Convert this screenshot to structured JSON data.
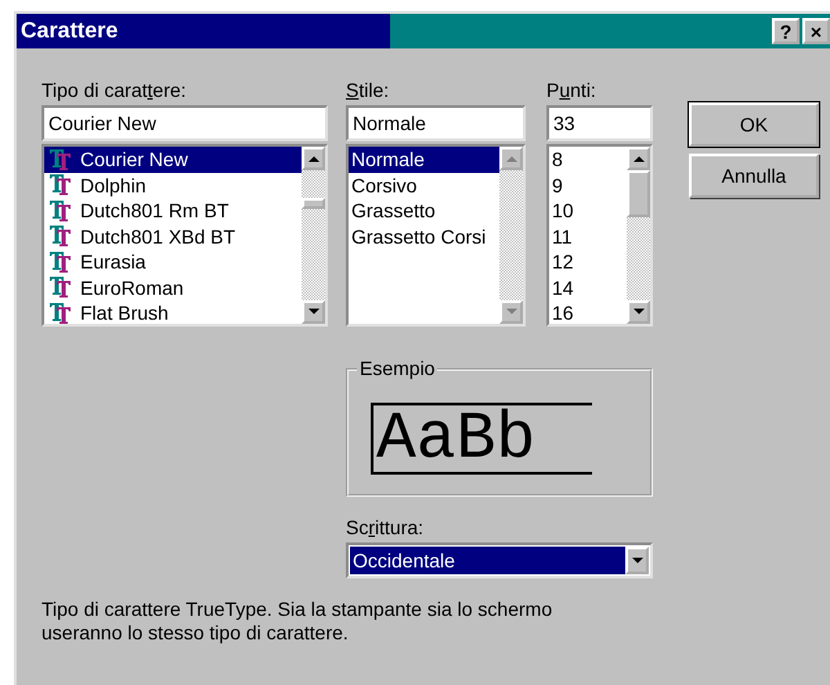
{
  "window": {
    "title": "Carattere",
    "title_buttons": [
      "?",
      "×"
    ]
  },
  "font": {
    "label": {
      "before": "Tipo di carat",
      "key": "t",
      "after": "ere:"
    },
    "value": "Courier New",
    "scrollbar_disabled": false,
    "items": [
      {
        "label": "Courier New",
        "selected": true
      },
      {
        "label": "Dolphin",
        "selected": false
      },
      {
        "label": "Dutch801 Rm BT",
        "selected": false
      },
      {
        "label": "Dutch801 XBd BT",
        "selected": false
      },
      {
        "label": "Eurasia",
        "selected": false
      },
      {
        "label": "EuroRoman",
        "selected": false
      },
      {
        "label": "Flat Brush",
        "selected": false
      }
    ]
  },
  "style": {
    "label": {
      "key": "S",
      "after": "tile:"
    },
    "value": "Normale",
    "scrollbar_disabled": true,
    "items": [
      {
        "label": "Normale",
        "selected": true
      },
      {
        "label": "Corsivo",
        "selected": false
      },
      {
        "label": "Grassetto",
        "selected": false
      },
      {
        "label": "Grassetto Corsi",
        "selected": false
      }
    ]
  },
  "size": {
    "label": {
      "before": "P",
      "key": "u",
      "after": "nti:"
    },
    "value": "33",
    "scrollbar_disabled": false,
    "items": [
      {
        "label": "8",
        "selected": false
      },
      {
        "label": "9",
        "selected": false
      },
      {
        "label": "10",
        "selected": false
      },
      {
        "label": "11",
        "selected": false
      },
      {
        "label": "12",
        "selected": false
      },
      {
        "label": "14",
        "selected": false
      },
      {
        "label": "16",
        "selected": false
      }
    ]
  },
  "buttons": [
    {
      "label": "OK",
      "default": true
    },
    {
      "label": "Annulla",
      "default": false
    }
  ],
  "sample": {
    "legend": "Esempio",
    "text": "AaBb"
  },
  "script": {
    "label": {
      "before": "Sc",
      "key": "r",
      "after": "ittura:"
    },
    "value": "Occidentale"
  },
  "description": "Tipo di carattere TrueType. Sia la stampante sia lo schermo useranno lo stesso tipo di carattere."
}
